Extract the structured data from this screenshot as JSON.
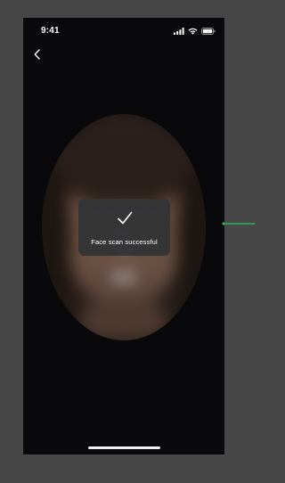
{
  "status_bar": {
    "time": "9:41",
    "icons": [
      "signal-icon",
      "wifi-icon",
      "battery-icon"
    ]
  },
  "navigation": {
    "back_icon": "chevron-left-icon"
  },
  "toast": {
    "icon": "checkmark-icon",
    "message": "Face scan successful"
  },
  "colors": {
    "screen_background": "#09090b",
    "canvas_background": "#474747",
    "toast_background": "#343436",
    "annotation_arrow": "#2fb05a"
  }
}
